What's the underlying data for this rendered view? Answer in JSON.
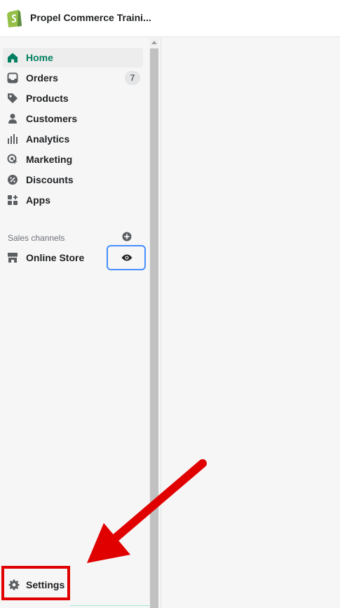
{
  "app": {
    "store_name": "Propel Commerce Traini..."
  },
  "sidebar": {
    "items": [
      {
        "label": "Home",
        "icon": "home-icon",
        "active": true
      },
      {
        "label": "Orders",
        "icon": "orders-icon",
        "badge": "7"
      },
      {
        "label": "Products",
        "icon": "tag-icon"
      },
      {
        "label": "Customers",
        "icon": "person-icon"
      },
      {
        "label": "Analytics",
        "icon": "bar-chart-icon"
      },
      {
        "label": "Marketing",
        "icon": "marketing-icon"
      },
      {
        "label": "Discounts",
        "icon": "discount-icon"
      },
      {
        "label": "Apps",
        "icon": "apps-icon"
      }
    ],
    "sales_channels": {
      "title": "Sales channels",
      "add_icon": "plus-circle-icon",
      "items": [
        {
          "label": "Online Store",
          "icon": "store-icon",
          "action_icon": "eye-icon"
        }
      ]
    },
    "settings": {
      "label": "Settings",
      "icon": "gear-icon"
    }
  },
  "colors": {
    "active_text": "#008060",
    "text": "#202223",
    "highlight": "#e00000",
    "focus_ring": "#458fff",
    "logo": "#95bf47"
  }
}
